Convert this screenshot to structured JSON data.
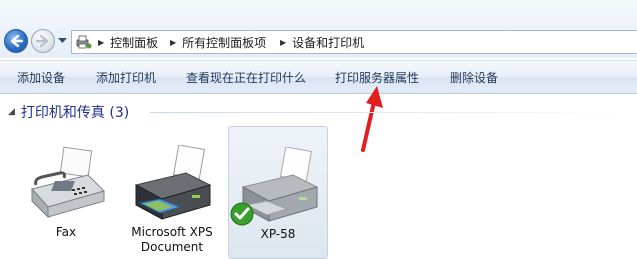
{
  "breadcrumb": [
    "控制面板",
    "所有控制面板项",
    "设备和打印机"
  ],
  "toolbar": {
    "add_device": "添加设备",
    "add_printer": "添加打印机",
    "see_printing": "查看现在正在打印什么",
    "print_server_props": "打印服务器属性",
    "remove_device": "删除设备"
  },
  "group": {
    "title": "打印机和传真 (3)"
  },
  "devices": [
    {
      "label": "Fax",
      "icon": "fax-icon"
    },
    {
      "label": "Microsoft XPS Document",
      "icon": "printer-icon"
    },
    {
      "label": "XP-58",
      "icon": "printer-icon",
      "default": true,
      "selected": true
    }
  ],
  "colors": {
    "annotation": "#e02020",
    "group_title": "#1e3287",
    "toolbar_text": "#1e395b"
  }
}
